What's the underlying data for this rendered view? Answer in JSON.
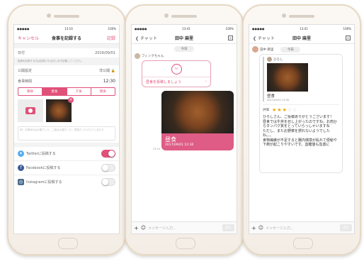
{
  "status": {
    "time": "13:10",
    "battery": "100%",
    "time2": "13:41"
  },
  "screen1": {
    "nav": {
      "cancel": "キャンセル",
      "title": "食事を記録する",
      "save": "記録"
    },
    "date_label": "日付",
    "date_value": "2016/09/01",
    "note": "投稿を記録する日は記録される日と必ず記載してください",
    "public_label": "公開設定",
    "public_value": "非公開",
    "time_label": "食事時間",
    "time_value": "12:30",
    "meals": [
      "朝食",
      "昼食",
      "夕食",
      "間食"
    ],
    "active_meal_index": 1,
    "memo_placeholder": "例）お昼休みはお腹でした。ご飯は大盛だった。野菜だったので少し控えた",
    "share": [
      {
        "label": "Twitterに投稿する",
        "icon": "twitter-icon",
        "color": "#55acee",
        "on": true
      },
      {
        "label": "Facebookに投稿する",
        "icon": "facebook-icon",
        "color": "#3b5998",
        "on": false
      },
      {
        "label": "Instagramに投稿する",
        "icon": "instagram-icon",
        "color": "#4a6d8c",
        "on": false
      }
    ]
  },
  "screen2": {
    "nav": {
      "back": "チャット",
      "title": "田中 麻里"
    },
    "date_chip": "今日",
    "sender": "フィンクちゃん",
    "prompt": "昼食を投稿しましょう",
    "sent_time": "13:19",
    "meal_title": "昼食",
    "meal_datetime": "2017/09/01 12:30",
    "input_placeholder": "メッセージ入力...",
    "send": "送信"
  },
  "screen3": {
    "nav": {
      "back": "チャット",
      "title": "田中 麻里"
    },
    "sender": "田中 麻里",
    "date_chip": "今日",
    "quoted_name": "ひろし",
    "quoted_title": "昼食",
    "quoted_datetime": "2017/09/01 12:30",
    "rating_label": "評価",
    "rating": 3,
    "rating_max": 5,
    "message": "ひろしさん、ご投稿ありがとうございます！\n昼食では牛丼を召し上がったのですね。お肉からタンパク質をとっていらっしゃいますね＾＾\nただし、またお野菜を摂れないようでしたね。。。\n食物繊維が不足すると腸内環境が乱れて便秘や下痢が起こりやすいです。血糖値も急激に",
    "input_placeholder": "メッセージ入力...",
    "send": "送信"
  },
  "colors": {
    "accent": "#e0517a"
  }
}
